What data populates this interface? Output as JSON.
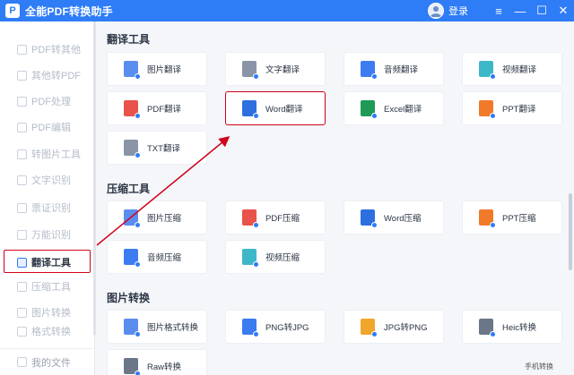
{
  "app": {
    "title": "全能PDF转换助手",
    "login_label": "登录"
  },
  "window_controls": [
    "≡",
    "—",
    "☐",
    "✕"
  ],
  "sidebar": {
    "items": [
      {
        "label": "PDF转其他"
      },
      {
        "label": "其他转PDF"
      },
      {
        "label": "PDF处理"
      },
      {
        "label": "PDF编辑"
      },
      {
        "label": "转图片工具"
      },
      {
        "label": "文字识别"
      },
      {
        "label": "票证识别"
      },
      {
        "label": "万能识别"
      },
      {
        "label": "翻译工具",
        "active": true
      },
      {
        "label": "压缩工具"
      },
      {
        "label": "图片转换"
      },
      {
        "label": "格式转换"
      }
    ],
    "bottom_label": "我的文件"
  },
  "sections": [
    {
      "title": "翻译工具",
      "cards": [
        {
          "label": "图片翻译",
          "icon": "image-translate-icon",
          "color": "#5b8def"
        },
        {
          "label": "文字翻译",
          "icon": "text-translate-icon",
          "color": "#8a94a6"
        },
        {
          "label": "音频翻译",
          "icon": "audio-translate-icon",
          "color": "#3d7bf0"
        },
        {
          "label": "视频翻译",
          "icon": "video-translate-icon",
          "color": "#3db8c9"
        },
        {
          "label": "PDF翻译",
          "icon": "pdf-translate-icon",
          "color": "#e8534a"
        },
        {
          "label": "Word翻译",
          "icon": "word-translate-icon",
          "color": "#2e6fe0",
          "highlight": true
        },
        {
          "label": "Excel翻译",
          "icon": "excel-translate-icon",
          "color": "#1f9a56"
        },
        {
          "label": "PPT翻译",
          "icon": "ppt-translate-icon",
          "color": "#f07a2a"
        },
        {
          "label": "TXT翻译",
          "icon": "txt-translate-icon",
          "color": "#8a94a6"
        }
      ]
    },
    {
      "title": "压缩工具",
      "cards": [
        {
          "label": "图片压缩",
          "icon": "image-compress-icon",
          "color": "#5b8def"
        },
        {
          "label": "PDF压缩",
          "icon": "pdf-compress-icon",
          "color": "#e8534a"
        },
        {
          "label": "Word压缩",
          "icon": "word-compress-icon",
          "color": "#2e6fe0"
        },
        {
          "label": "PPT压缩",
          "icon": "ppt-compress-icon",
          "color": "#f07a2a"
        },
        {
          "label": "音频压缩",
          "icon": "audio-compress-icon",
          "color": "#3d7bf0"
        },
        {
          "label": "视频压缩",
          "icon": "video-compress-icon",
          "color": "#3db8c9"
        }
      ]
    },
    {
      "title": "图片转换",
      "cards": [
        {
          "label": "图片格式转换",
          "icon": "image-format-icon",
          "color": "#5b8def"
        },
        {
          "label": "PNG转JPG",
          "icon": "png-to-jpg-icon",
          "color": "#3d7bf0"
        },
        {
          "label": "JPG转PNG",
          "icon": "jpg-to-png-icon",
          "color": "#f0a62a"
        },
        {
          "label": "Heic转换",
          "icon": "heic-convert-icon",
          "color": "#6b7688"
        },
        {
          "label": "Raw转换",
          "icon": "raw-convert-icon",
          "color": "#6b7688"
        }
      ]
    }
  ],
  "watermark": "手机转换"
}
